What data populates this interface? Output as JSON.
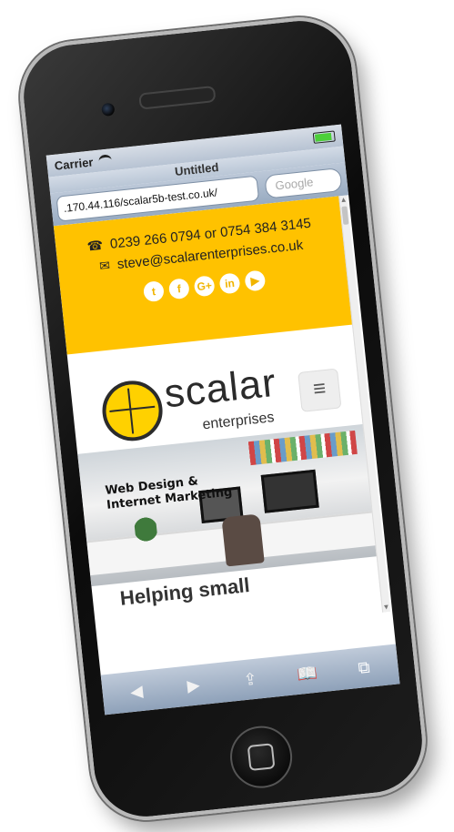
{
  "status_bar": {
    "carrier": "Carrier",
    "title": "Untitled"
  },
  "address_bar": {
    "url": ".170.44.116/scalar5b-test.co.uk/",
    "search_placeholder": "Google"
  },
  "contact": {
    "phone": "0239 266 0794 or 0754 384 3145",
    "email": "steve@scalarenterprises.co.uk"
  },
  "socials": [
    "twitter-icon",
    "facebook-icon",
    "google-plus-icon",
    "linkedin-icon",
    "youtube-icon"
  ],
  "brand": {
    "name": "scalar",
    "tagline": "enterprises"
  },
  "hero": {
    "line1": "Web Design &",
    "line2": "Internet Marketing"
  },
  "page_heading": "Helping small",
  "toolbar": [
    "back-icon",
    "forward-icon",
    "share-icon",
    "bookmarks-icon",
    "tabs-icon"
  ],
  "colors": {
    "topbar": "#ffc200",
    "logo_globe": "#ffd100",
    "toolbar": "#8ea1b9"
  }
}
